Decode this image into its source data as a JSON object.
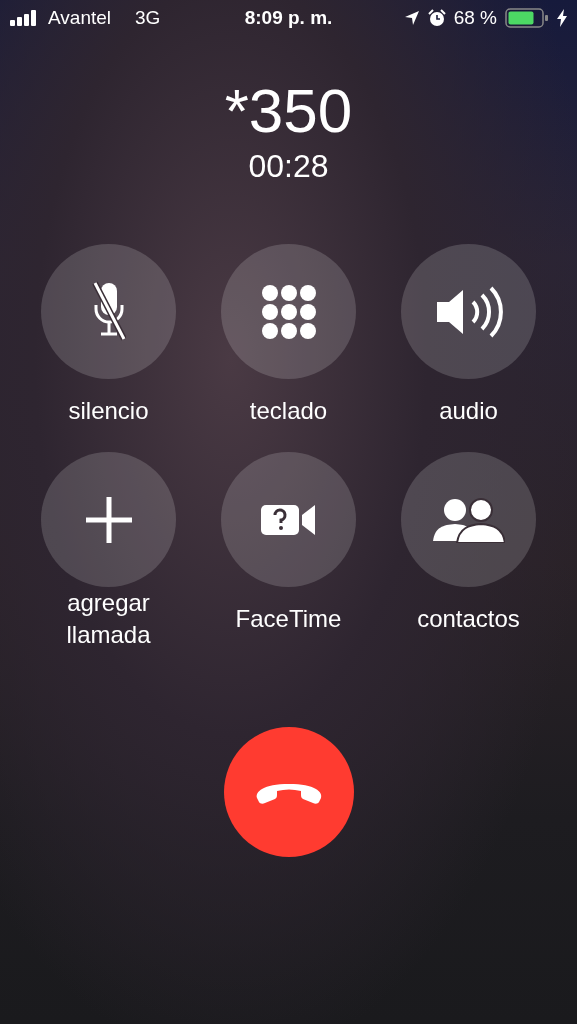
{
  "status_bar": {
    "carrier": "Avantel",
    "network": "3G",
    "time": "8:09 p. m.",
    "battery_percent": "68 %"
  },
  "call": {
    "number": "*350",
    "duration": "00:28"
  },
  "buttons": [
    {
      "kind": "mute",
      "label": "silencio"
    },
    {
      "kind": "keypad",
      "label": "teclado"
    },
    {
      "kind": "speaker",
      "label": "audio"
    },
    {
      "kind": "add",
      "label": "agregar llamada"
    },
    {
      "kind": "facetime",
      "label": "FaceTime"
    },
    {
      "kind": "contacts",
      "label": "contactos"
    }
  ],
  "end_call": {
    "kind": "end"
  }
}
